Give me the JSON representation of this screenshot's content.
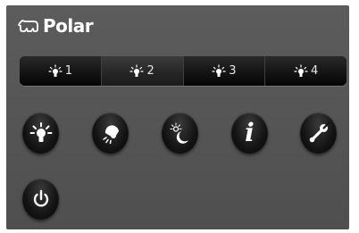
{
  "brand": {
    "logo_icon": "polar-bear-icon",
    "name": "Polar"
  },
  "light_modes": [
    {
      "number": "1",
      "icon": "light-bulb-icon",
      "selected": false
    },
    {
      "number": "2",
      "icon": "light-bulb-icon",
      "selected": true
    },
    {
      "number": "3",
      "icon": "light-bulb-icon",
      "selected": false
    },
    {
      "number": "4",
      "icon": "light-bulb-icon",
      "selected": false
    }
  ],
  "controls": [
    {
      "icon": "light-bulb-icon"
    },
    {
      "icon": "night-light-icon"
    },
    {
      "icon": "day-night-icon"
    },
    {
      "icon": "info-icon",
      "glyph": "i"
    },
    {
      "icon": "wrench-icon"
    },
    {
      "icon": "power-icon"
    }
  ],
  "colors": {
    "panel": "#565656",
    "button": "#141414",
    "icon": "#ffffff"
  }
}
